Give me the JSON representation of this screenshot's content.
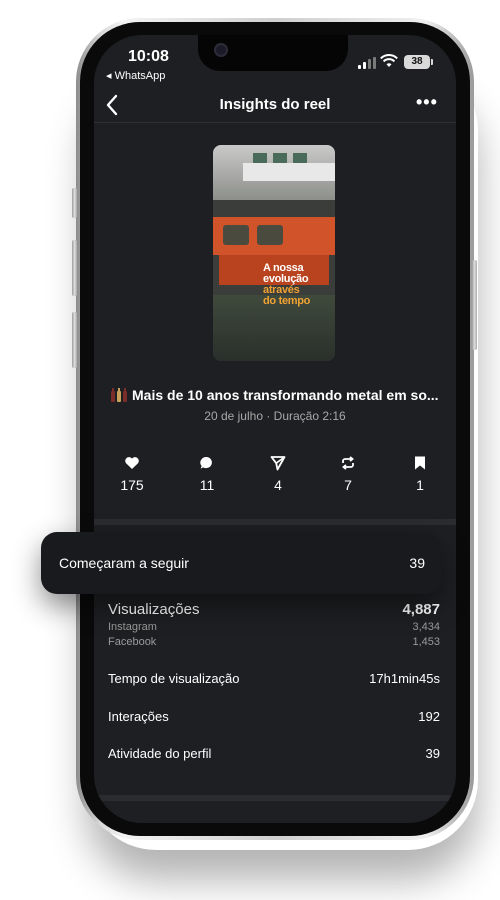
{
  "status_bar": {
    "time": "10:08",
    "back_app": "◂ WhatsApp",
    "battery": "38"
  },
  "nav": {
    "title": "Insights do reel"
  },
  "reel": {
    "thumbnail_text": {
      "line1": "A nossa",
      "line2": "evolução",
      "line3": "através",
      "line4": "do tempo"
    },
    "caption": "Mais de 10 anos transformando metal em so...",
    "meta": "20 de julho · Duração 2:16"
  },
  "stats": {
    "likes": "175",
    "comments": "11",
    "shares": "4",
    "reposts": "7",
    "saves": "1"
  },
  "followers": {
    "label": "Começaram a seguir",
    "value": "39"
  },
  "metrics": {
    "views": {
      "label": "Visualizações",
      "value": "4,887"
    },
    "instagram": {
      "label": "Instagram",
      "value": "3,434"
    },
    "facebook": {
      "label": "Facebook",
      "value": "1,453"
    },
    "watch_time": {
      "label": "Tempo de visualização",
      "value": "17h1min45s"
    },
    "interactions": {
      "label": "Interações",
      "value": "192"
    },
    "profile_activity": {
      "label": "Atividade do perfil",
      "value": "39"
    }
  }
}
